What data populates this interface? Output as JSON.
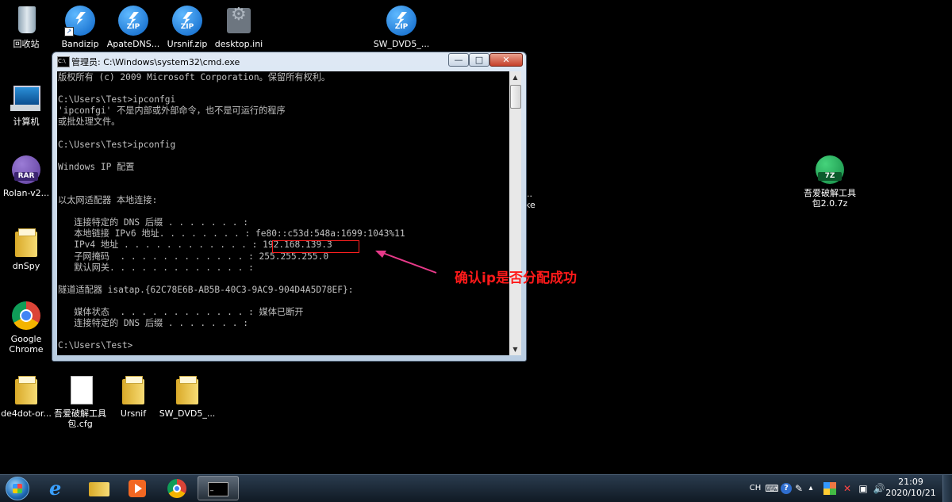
{
  "desktop": {
    "icons": [
      {
        "label": "回收站"
      },
      {
        "label": "Bandizip"
      },
      {
        "label": "ApateDNS..."
      },
      {
        "label": "Ursnif.zip"
      },
      {
        "label": "desktop.ini"
      },
      {
        "label": "SW_DVD5_..."
      },
      {
        "label": "计算机"
      },
      {
        "label": "Rolan-v2..."
      },
      {
        "label": "dnSpy"
      },
      {
        "label": "Google Chrome"
      },
      {
        "label": "de4dot-or..."
      },
      {
        "label": "吾爱破解工具包.cfg"
      },
      {
        "label": "Ursnif"
      },
      {
        "label": "SW_DVD5_..."
      },
      {
        "label": "吾爱破解工具包2.0.7z"
      }
    ],
    "tags": {
      "zip": "ZIP",
      "rar": "RAR",
      "sevenz": "7Z"
    },
    "partial_texts": {
      "a": "..",
      "b": "ke"
    }
  },
  "cmd_window": {
    "title": "管理员: C:\\Windows\\system32\\cmd.exe",
    "controls": {
      "minimize": "—",
      "maximize": "□",
      "close": "✕"
    },
    "console_text": "版权所有 (c) 2009 Microsoft Corporation。保留所有权利。\n\nC:\\Users\\Test>ipconfgi\n'ipconfgi' 不是内部或外部命令，也不是可运行的程序\n或批处理文件。\n\nC:\\Users\\Test>ipconfig\n\nWindows IP 配置\n\n\n以太网适配器 本地连接:\n\n   连接特定的 DNS 后缀 . . . . . . . :\n   本地链接 IPv6 地址. . . . . . . . : fe80::c53d:548a:1699:1043%11\n   IPv4 地址 . . . . . . . . . . . . : 192.168.139.3\n   子网掩码  . . . . . . . . . . . . : 255.255.255.0\n   默认网关. . . . . . . . . . . . . :\n\n隧道适配器 isatap.{62C78E6B-AB5B-40C3-9AC9-904D4A5D78EF}:\n\n   媒体状态  . . . . . . . . . . . . : 媒体已断开\n   连接特定的 DNS 后缀 . . . . . . . :\n\nC:\\Users\\Test>"
  },
  "annotation": {
    "text": "确认ip是否分配成功",
    "color": "#ff1a1a"
  },
  "taskbar": {
    "tray": {
      "lang": "CH",
      "help": "?"
    },
    "clock": {
      "time": "21:09",
      "date": "2020/10/21"
    }
  }
}
